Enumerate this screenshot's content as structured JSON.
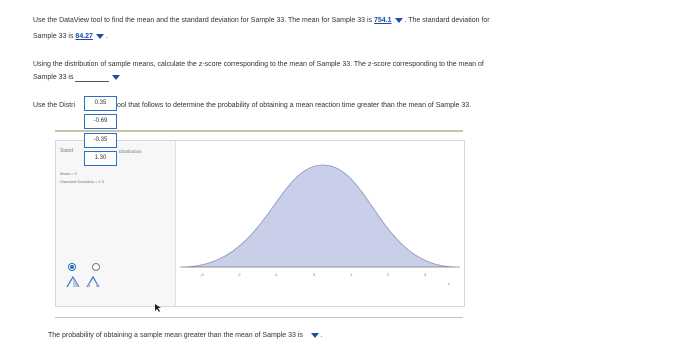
{
  "q1": {
    "pre": "Use the DataView tool to find the mean and the standard deviation for Sample 33. The mean for Sample 33 is",
    "mean_value": "754.1",
    "mid": ". The standard deviation for",
    "line2_pre": "Sample 33 is",
    "sd_value": "84.27",
    "end": "."
  },
  "q2": {
    "line1": "Using the distribution of sample means, calculate the z-score corresponding to the mean of Sample 33. The z-score corresponding to the mean of",
    "line2": "Sample 33 is"
  },
  "q3": {
    "pre": "Use the Distri",
    "post": "ool that follows to determine the probability of obtaining a mean reaction time greater than the mean of Sample 33."
  },
  "dropdown_options": [
    "0.35",
    "-0.69",
    "-0.35",
    "1.30"
  ],
  "tool": {
    "label_stand": "Stand",
    "label_distribution": "Distribution",
    "mean_label": "Mean = 0",
    "sd_label": "Standard Deviation = 1.0",
    "x_ticks": [
      "-3",
      "-2",
      "-1",
      "0",
      "1",
      "2",
      "3"
    ],
    "x_end": "x"
  },
  "q4": {
    "text": "The probability of obtaining a sample mean greater than the mean of Sample 33 is"
  },
  "colors": {
    "accent": "#1a4ea8",
    "curve_fill": "#c9cfe9",
    "divider": "#c7c2a8"
  }
}
